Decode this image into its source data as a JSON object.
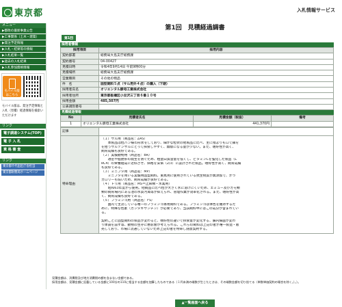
{
  "header": {
    "logo_text": "東京都",
    "system_name": "入札情報サービス"
  },
  "sidebar": {
    "menu_header": "メニュー",
    "items": [
      "▶都政の最新事業公告",
      "▶工事関係（土木・建築）",
      "▶発注予定情報",
      "▶入札・結果等の情報",
      "▶入札結果一覧",
      "▶過去の入札結果",
      "▶入札参加資格情報"
    ],
    "mobile_label": "モバイル版",
    "mobile_sub": "はこちら",
    "note": "モバイル版は、発注予定情報と入札（見積）経過情報を検索いただけます",
    "big_links_header": "リンク",
    "big_links": [
      "電子調達システム(TOP)",
      "電 子 入 札",
      "資 格 審 査"
    ],
    "bottom_header": "リンク",
    "bottom_links": [
      "東京都千代田区庁舎担当",
      "東京都財務局ホームページ"
    ]
  },
  "page": {
    "title": "第1回　見積経過調書",
    "tab": "第1回",
    "section1": "採用者情報",
    "col_item": "採用項目",
    "col_content": "採用内容",
    "rows": [
      [
        "契約部署",
        "総務局大島支庁総務課"
      ],
      [
        "契約番号",
        "04-00427"
      ],
      [
        "見積日時",
        "令和4年9月14日 午前9時00分"
      ],
      [
        "見積場所",
        "総務局大島支庁総務課"
      ],
      [
        "営業種目",
        "その他の物品"
      ],
      [
        "件　名",
        "固型飼料５点（サル用外４点）の購入（下期）"
      ],
      [
        "採用者氏名",
        "オリエンタル酵母工業株式会社"
      ],
      [
        "採用者住所",
        "東京都板橋区小豆沢三丁目６番１０号"
      ],
      [
        "採用金額",
        "485,507円"
      ],
      [
        "公表識別番号",
        ""
      ]
    ],
    "section2": "見積経過情報",
    "h_no": "No",
    "h_name": "見積者氏名",
    "h_amount": "見積金額（税抜）",
    "h_note": "備考",
    "bid_no": "1",
    "bid_name": "オリエンタル酵母工業株式会社",
    "bid_amount": "441,370円",
    "bid_note": "",
    "remarks_label": "記事",
    "remarks_value": "",
    "reason_label": "特命理由",
    "reason_lines": [
      "（１）サル用（商品名：ZAS）",
      "　　本製品は粒パン様の形状をしており、細かな粒状の他製品に比べ、主に指よりもロで餌を",
      "を拾うサルテンザルにとって採食しやすく、無駄になる量が少ない。また、嗜好性が高く、",
      "飼育成績も良好である。",
      "（２）実験動物用（商品名：BR）",
      "　　適密や脂肪肝の発生を防ぐため、粗蛋白質含量を低くし、ビタミンCを強化した製品（L",
      "RC4）の栄養組成に近似させ、価格を安価（2/3）に設計された製品。嗜好性が高く、飼育成績",
      "も良好である。",
      "（３）ミニブタ用（商品名：MP）",
      "　　ミニブタを用いる実験用固型飼料。重篤用に使用されている抗生物質が無添加で、かつ",
      "カロリーも低いため、飼育成績が良好である。",
      "（４）トリ用（商品名：MS＝止麻類・水禽用）",
      "　　昭和63年度から使用。他飼品に比べ粒が大きく水に溶けにくいため、エミュー及びカモ類",
      "類の飼育場内にある池の水質汚濁等が抑えられ、管理作業が効率化される。また、嗜好性が高",
      "く、飼育成績も良好である。",
      "（５）フラミンゴ用（商品名：FS）",
      "　　国内で主流している唯一のフラミンゴ専用飼料である。フラミンゴは体色を維持するた",
      "めに、特殊な色素（カンタキサンチン）が必要であり、当該飼料中にはこの成分が含まれてい",
      "る。",
      "",
      "契約ごとに固型飼料の製品が変わると、嗜好性の違いで摂食量が変化する、腸内細菌が変わ",
      "り体調を崩す等、動物の生存に悪影響が考えられる。これらの飼料は上記の者が唯一製造・販",
      "売しており、市場に流通していないため上記の者を特命し随意契約する。"
    ],
    "notes": [
      "見積金額は、消費税及び地方消費税の額を含まない金額である。",
      "採用金額は、見積金額に記載している金額に100分の110に相当する金額を加算したものである（１円未満の端数が生じたときは、その端数金額を切り捨てる（単数単価契約の場合を除く。）。）。"
    ],
    "back_label": "▲一覧画面へ戻る"
  }
}
